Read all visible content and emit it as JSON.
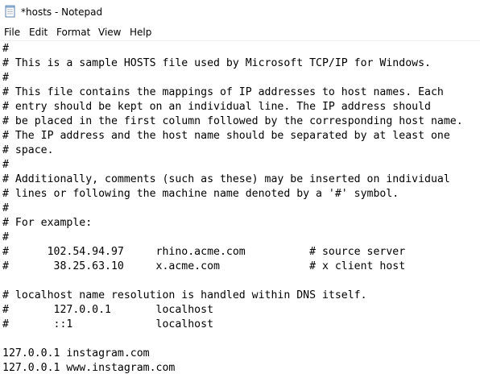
{
  "window": {
    "title": "*hosts - Notepad",
    "icon": "notepad-icon"
  },
  "menu": [
    "File",
    "Edit",
    "Format",
    "View",
    "Help"
  ],
  "editor": {
    "lines": [
      "#",
      "# This is a sample HOSTS file used by Microsoft TCP/IP for Windows.",
      "#",
      "# This file contains the mappings of IP addresses to host names. Each",
      "# entry should be kept on an individual line. The IP address should",
      "# be placed in the first column followed by the corresponding host name.",
      "# The IP address and the host name should be separated by at least one",
      "# space.",
      "#",
      "# Additionally, comments (such as these) may be inserted on individual",
      "# lines or following the machine name denoted by a '#' symbol.",
      "#",
      "# For example:",
      "#",
      "#      102.54.94.97     rhino.acme.com          # source server",
      "#       38.25.63.10     x.acme.com              # x client host",
      "",
      "# localhost name resolution is handled within DNS itself.",
      "#       127.0.0.1       localhost",
      "#       ::1             localhost",
      "",
      "127.0.0.1 instagram.com",
      "127.0.0.1 www.instagram.com"
    ]
  }
}
